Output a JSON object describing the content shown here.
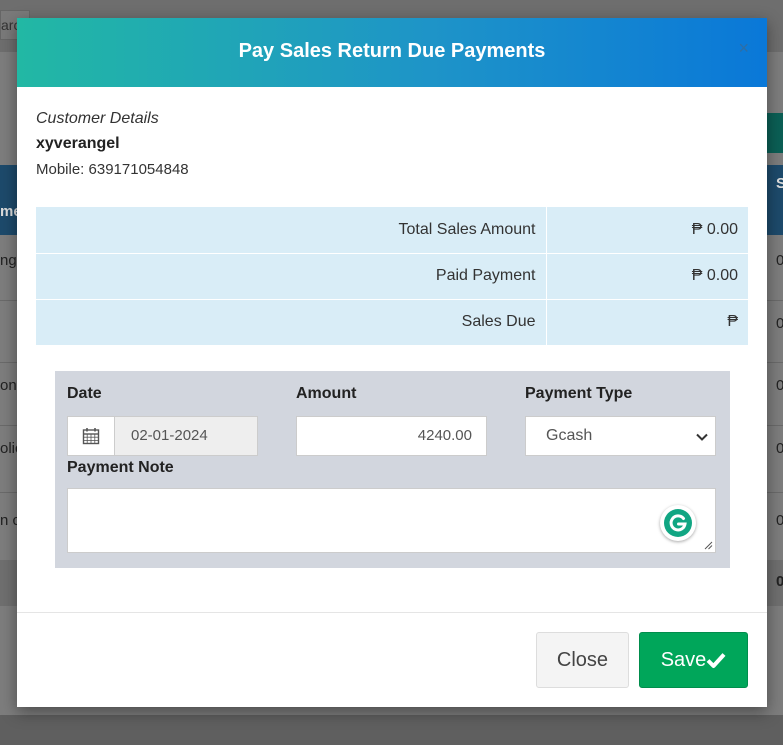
{
  "background": {
    "search_fragment": "arc",
    "table_fragments": [
      "me",
      "ng",
      "ond",
      "olic",
      "n c"
    ],
    "right_fragments": [
      "S",
      "0",
      "0",
      "0",
      "0",
      "0",
      "0"
    ]
  },
  "modal": {
    "title": "Pay Sales Return Due Payments",
    "close_symbol": "×"
  },
  "customer": {
    "heading": "Customer Details",
    "name": "xyverangel",
    "mobile": "Mobile: 639171054848"
  },
  "summary": {
    "rows": [
      {
        "label": "Total Sales Amount",
        "value": "₱ 0.00"
      },
      {
        "label": "Paid Payment",
        "value": "₱ 0.00"
      },
      {
        "label": "Sales Due",
        "value": "₱"
      }
    ]
  },
  "payment": {
    "date_label": "Date",
    "date_value": "02-01-2024",
    "amount_label": "Amount",
    "amount_value": "4240.00",
    "type_label": "Payment Type",
    "type_value": "Gcash",
    "note_label": "Payment Note",
    "note_value": ""
  },
  "footer": {
    "close_label": "Close",
    "save_label": "Save"
  },
  "icons": {
    "calendar": "calendar-icon",
    "chevron": "chevron-down-icon",
    "check": "check-icon",
    "grammarly": "grammarly-icon"
  },
  "colors": {
    "header_start": "#22b8a4",
    "header_end": "#0a78d8",
    "save_button": "#00a65a",
    "summary_bg": "#d9edf7",
    "pay_box_bg": "#d2d6de"
  }
}
